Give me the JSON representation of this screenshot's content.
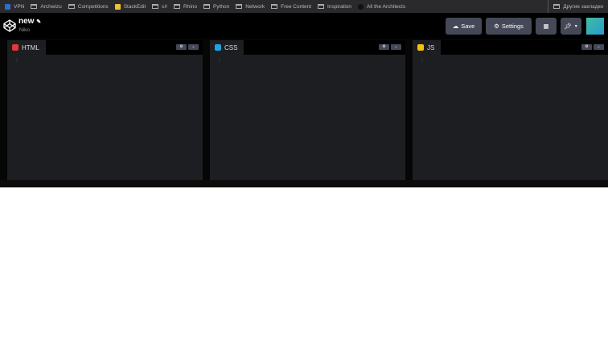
{
  "bookmarks": [
    {
      "label": "VPN",
      "icon": "vpn-icon"
    },
    {
      "label": "Archwizu",
      "icon": "folder-icon"
    },
    {
      "label": "Competitions",
      "icon": "folder-icon"
    },
    {
      "label": "StackEdit",
      "icon": "stackedit-icon"
    },
    {
      "label": "c#",
      "icon": "folder-icon"
    },
    {
      "label": "Rhino",
      "icon": "folder-icon"
    },
    {
      "label": "Python",
      "icon": "folder-icon"
    },
    {
      "label": "Network",
      "icon": "folder-icon"
    },
    {
      "label": "Free Content",
      "icon": "folder-icon"
    },
    {
      "label": "Inspiration",
      "icon": "folder-icon"
    },
    {
      "label": "All the Architects",
      "icon": "site-icon"
    }
  ],
  "other_bookmarks": "Другие закладки",
  "header": {
    "title": "new",
    "user": "Niko",
    "save": "Save",
    "settings": "Settings"
  },
  "panels": [
    {
      "label": "HTML",
      "color": "#e53935",
      "line": "1"
    },
    {
      "label": "CSS",
      "color": "#1fa3e0",
      "line": "1"
    },
    {
      "label": "JS",
      "color": "#f4c20d",
      "line": "1"
    }
  ]
}
